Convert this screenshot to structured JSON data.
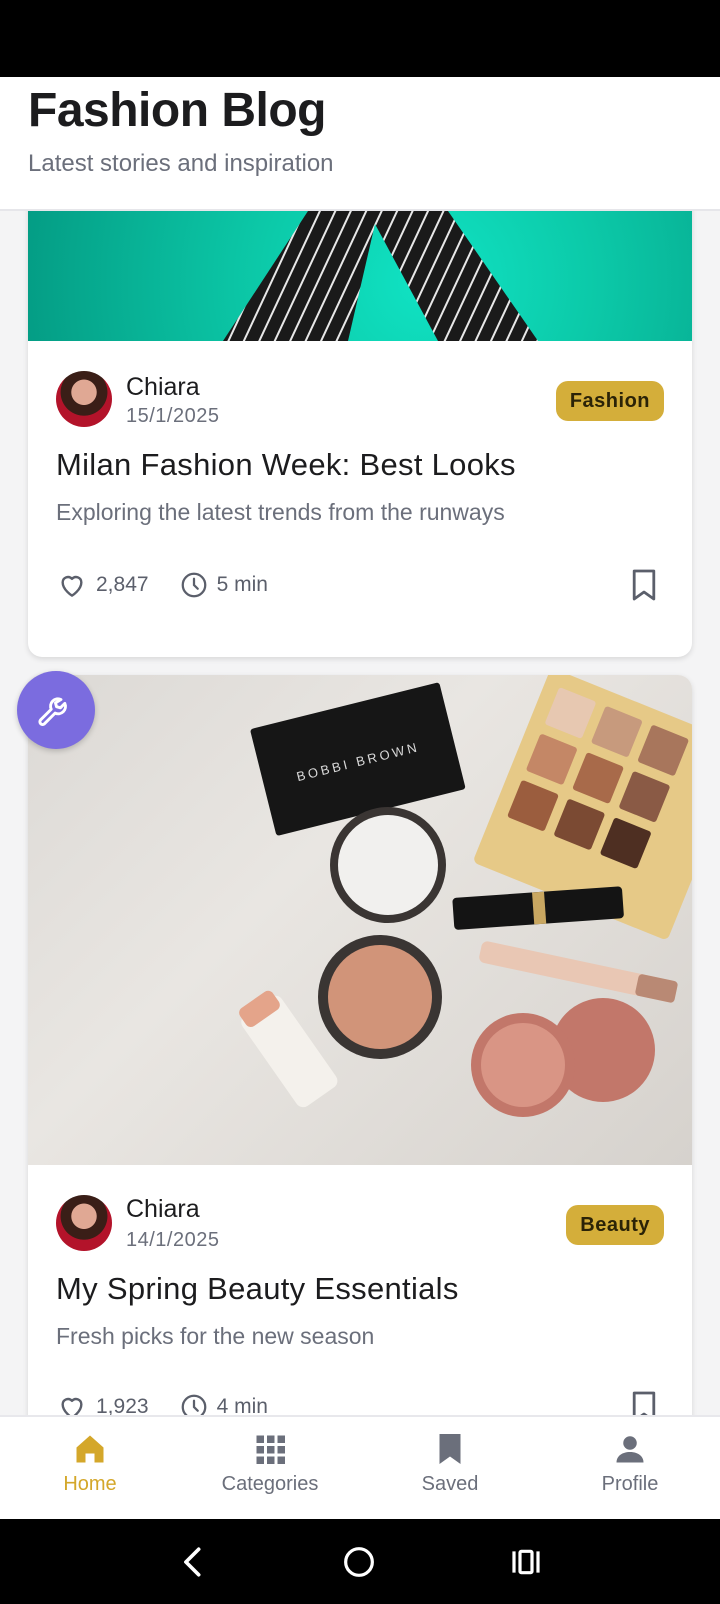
{
  "header": {
    "title": "Fashion Blog",
    "subtitle": "Latest stories and inspiration"
  },
  "posts": [
    {
      "author": "Chiara",
      "date": "15/1/2025",
      "category": "Fashion",
      "title": "Milan Fashion Week: Best Looks",
      "excerpt": "Exploring the latest trends from the runways",
      "likes": "2,847",
      "read_time": "5 min"
    },
    {
      "author": "Chiara",
      "date": "14/1/2025",
      "category": "Beauty",
      "title": "My Spring Beauty Essentials",
      "excerpt": "Fresh picks for the new season",
      "likes": "1,923",
      "read_time": "4 min"
    }
  ],
  "image_text": {
    "compact_brand": "BOBBI BROWN"
  },
  "nav": {
    "items": [
      {
        "label": "Home",
        "icon": "home-icon",
        "active": true
      },
      {
        "label": "Categories",
        "icon": "grid-icon",
        "active": false
      },
      {
        "label": "Saved",
        "icon": "bookmark-icon",
        "active": false
      },
      {
        "label": "Profile",
        "icon": "person-icon",
        "active": false
      }
    ]
  },
  "colors": {
    "accent": "#d4a72a",
    "badge": "#d4ae3a",
    "fab": "#7b6cdf"
  }
}
